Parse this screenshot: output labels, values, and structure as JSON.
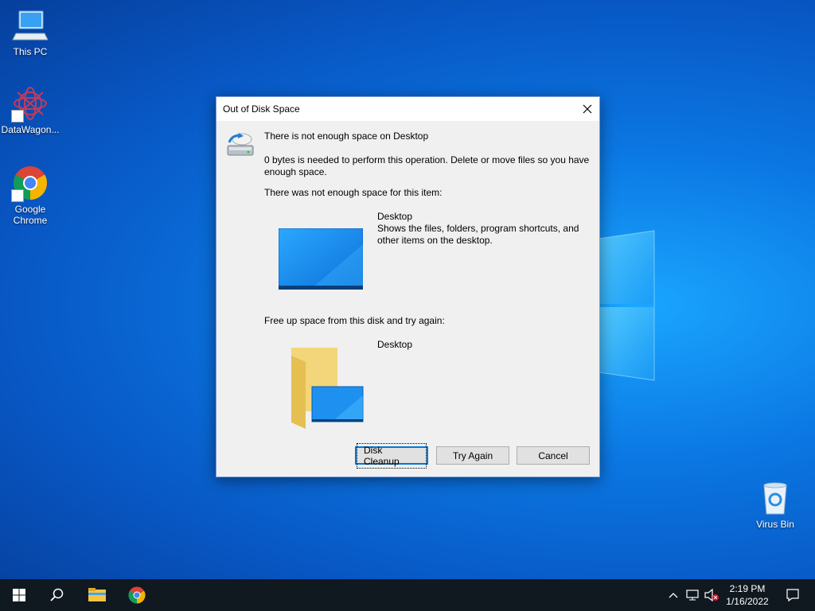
{
  "desktop": {
    "icons": [
      {
        "label": "This PC",
        "icon": "computer-icon"
      },
      {
        "label": "DataWagon...",
        "icon": "datawagon-icon"
      },
      {
        "label": "Google Chrome",
        "icon": "chrome-icon"
      },
      {
        "label": "Virus Bin",
        "icon": "recycle-bin-icon"
      }
    ]
  },
  "dialog": {
    "title": "Out of Disk Space",
    "heading": "There is not enough space on Desktop",
    "message": "0 bytes is needed to perform this operation. Delete or move files so you have enough space.",
    "item_section_label": "There was not enough space for this item:",
    "item": {
      "name": "Desktop",
      "description": "Shows the files, folders, program shortcuts, and other items on the desktop."
    },
    "free_section_label": "Free up space from this disk and try again:",
    "disk": {
      "name": "Desktop"
    },
    "buttons": {
      "disk_cleanup": "Disk Cleanup",
      "try_again": "Try Again",
      "cancel": "Cancel"
    }
  },
  "taskbar": {
    "clock_time": "2:19 PM",
    "clock_date": "1/16/2022"
  },
  "colors": {
    "accent": "#0078d7",
    "taskbar": "#101820"
  }
}
